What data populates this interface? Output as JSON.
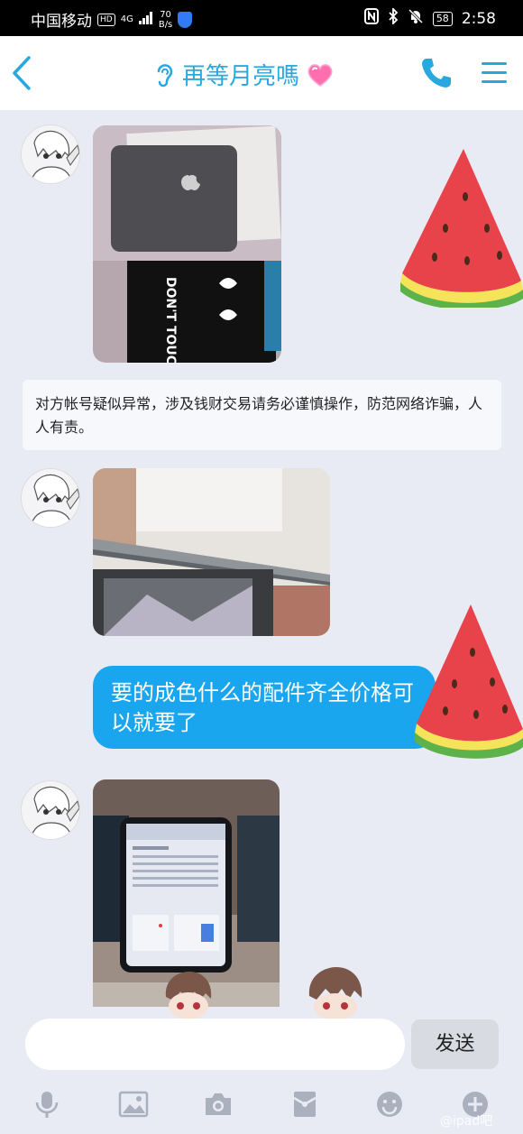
{
  "status_bar": {
    "carrier": "中国移动",
    "hd": "HD",
    "signal": "4G",
    "speed_value": "70",
    "speed_unit": "B/s",
    "battery": "58",
    "time": "2:58"
  },
  "header": {
    "title": "再等月亮嗎"
  },
  "messages": {
    "notice": "对方帐号疑似异常，涉及钱财交易请务必谨慎操作，防范网络诈骗，人人有责。",
    "bubble_text": "要的成色什么的配件齐全价格可以就要了",
    "photo1_case_text": "DON'T TOUCH ME"
  },
  "input": {
    "send_label": "发送"
  },
  "toolbar": {
    "icons": [
      "microphone-icon",
      "image-icon",
      "camera-icon",
      "red-packet-icon",
      "emoji-icon",
      "plus-icon"
    ]
  },
  "watermark": "@ipad吧",
  "colors": {
    "accent": "#29a8e0",
    "bubble": "#1aa6ee",
    "background": "#e9ebf4"
  }
}
